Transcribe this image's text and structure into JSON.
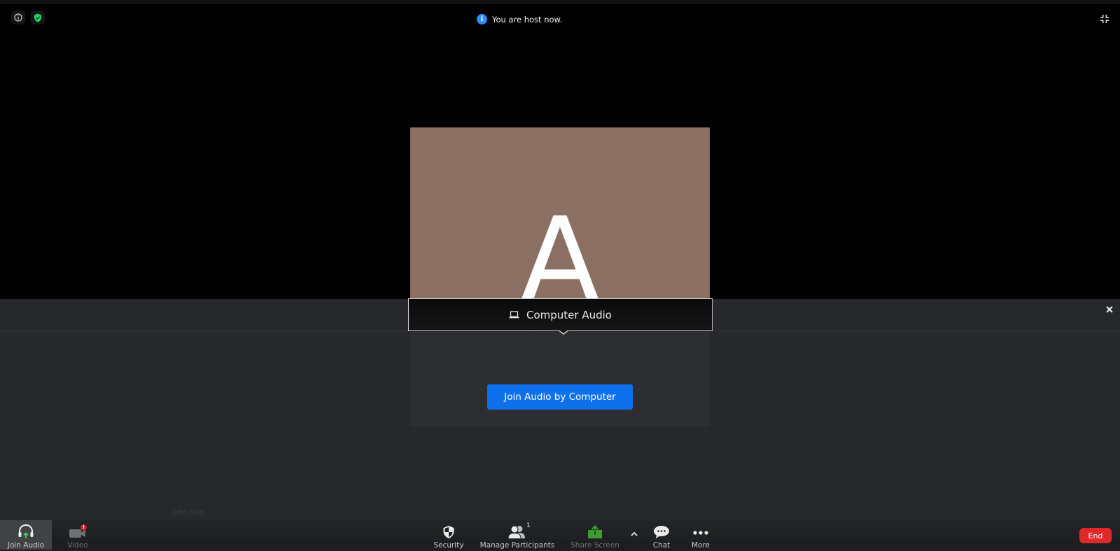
{
  "top_bar": {
    "info_icon": "info-icon",
    "security_status_icon": "shield-check-icon",
    "host_notice": "You are host now.",
    "fullscreen_icon": "exit-fullscreen-icon"
  },
  "video": {
    "avatar_letter": "A",
    "avatar_bg_color": "#8c6f63",
    "participant_name": "John Doe"
  },
  "audio_panel": {
    "tab_label": "Computer Audio",
    "tab_icon": "laptop-icon",
    "join_button_label": "Join Audio by Computer",
    "close_icon": "close-icon"
  },
  "toolbar": {
    "join_audio_label": "Join Audio",
    "video_label": "Video",
    "video_alert": "!",
    "security_label": "Security",
    "participants_label": "Manage Participants",
    "participants_count": "1",
    "share_label": "Share Screen",
    "chat_label": "Chat",
    "more_label": "More",
    "end_label": "End"
  },
  "colors": {
    "accent_blue": "#0e71eb",
    "end_red": "#e02828",
    "share_green": "#3b9c2f",
    "secure_green": "#23d959",
    "info_blue": "#2d8cff"
  }
}
